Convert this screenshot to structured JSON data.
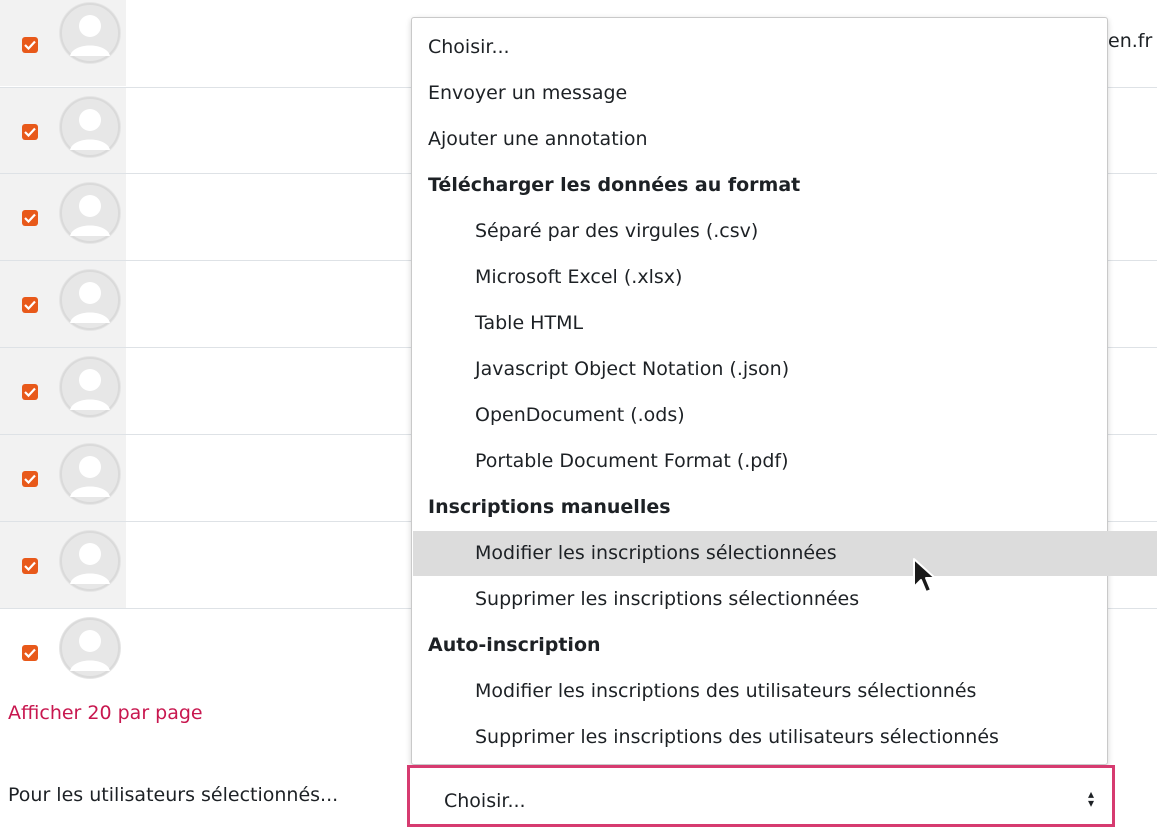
{
  "participants": {
    "row_count": 8,
    "email_fragment": "en.fr"
  },
  "bulk_actions": {
    "label": "Pour les utilisateurs sélectionnés...",
    "selected_value": "Choisir...",
    "options": [
      {
        "label": "Choisir...",
        "kind": "option"
      },
      {
        "label": "Envoyer un message",
        "kind": "option"
      },
      {
        "label": "Ajouter une annotation",
        "kind": "option"
      },
      {
        "label": "Télécharger les données au format",
        "kind": "group"
      },
      {
        "label": "Séparé par des virgules (.csv)",
        "kind": "sub"
      },
      {
        "label": "Microsoft Excel (.xlsx)",
        "kind": "sub"
      },
      {
        "label": "Table HTML",
        "kind": "sub"
      },
      {
        "label": "Javascript Object Notation (.json)",
        "kind": "sub"
      },
      {
        "label": "OpenDocument (.ods)",
        "kind": "sub"
      },
      {
        "label": "Portable Document Format (.pdf)",
        "kind": "sub"
      },
      {
        "label": "Inscriptions manuelles",
        "kind": "group"
      },
      {
        "label": "Modifier les inscriptions sélectionnées",
        "kind": "sub",
        "highlighted": true
      },
      {
        "label": "Supprimer les inscriptions sélectionnées",
        "kind": "sub"
      },
      {
        "label": "Auto-inscription",
        "kind": "group"
      },
      {
        "label": "Modifier les inscriptions des utilisateurs sélectionnés",
        "kind": "sub"
      },
      {
        "label": "Supprimer les inscriptions des utilisateurs sélectionnés",
        "kind": "sub"
      }
    ]
  },
  "pagination": {
    "show_per_page": "Afficher 20 par page"
  },
  "colors": {
    "checkbox": "#e8591a",
    "link": "#c8174f",
    "focus_border": "#d63b70",
    "highlight": "#dcdcdc"
  }
}
